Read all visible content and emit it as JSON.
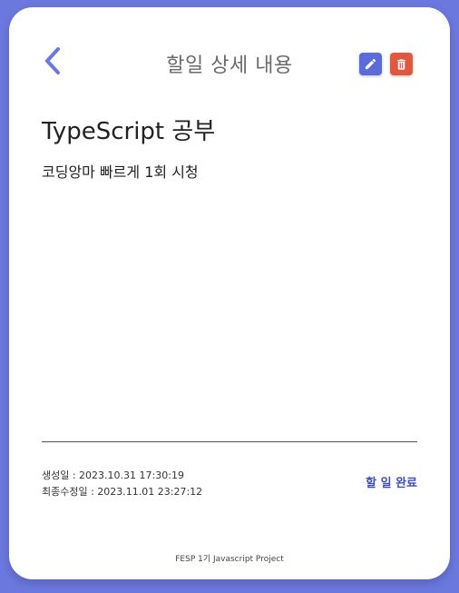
{
  "header": {
    "back_icon": "chevron-left-icon",
    "title": "할일 상세 내용",
    "edit_icon": "pencil-icon",
    "delete_icon": "trash-icon"
  },
  "todo": {
    "title": "TypeScript 공부",
    "content": "코딩앙마 빠르게 1회 시청",
    "created_label": "생성일 : 2023.10.31 17:30:19",
    "updated_label": "최종수정일 : 2023.11.01 23:27:12",
    "complete_label": "할 일 완료"
  },
  "footer": {
    "text": "FESP 1기 Javascript Project"
  },
  "colors": {
    "background": "#6b78de",
    "accent": "#5b6bd9",
    "danger": "#e0593f",
    "complete_text": "#3c4fb8"
  }
}
